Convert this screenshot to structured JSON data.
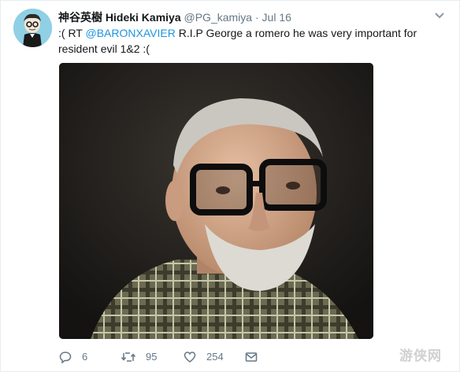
{
  "tweet": {
    "display_name": "神谷英樹 Hideki Kamiya",
    "handle": "@PG_kamiya",
    "separator": "·",
    "date": "Jul 16",
    "text_prefix": ":( RT ",
    "mention": "@BARONXAVIER",
    "text_line1_rest": " R.I.P George a romero he was very important for",
    "text_line2": "resident evil 1&2 :(",
    "media_icon": "portrait-photo",
    "actions": {
      "reply_icon": "reply-icon",
      "reply_count": "6",
      "retweet_icon": "retweet-icon",
      "retweet_count": "95",
      "like_icon": "heart-icon",
      "like_count": "254",
      "dm_icon": "envelope-icon"
    }
  },
  "watermark": {
    "text": "游侠网"
  },
  "colors": {
    "link": "#1b95e0",
    "secondary_text": "#657786",
    "primary_text": "#14171a",
    "avatar_bg": "#8fd0e4"
  }
}
